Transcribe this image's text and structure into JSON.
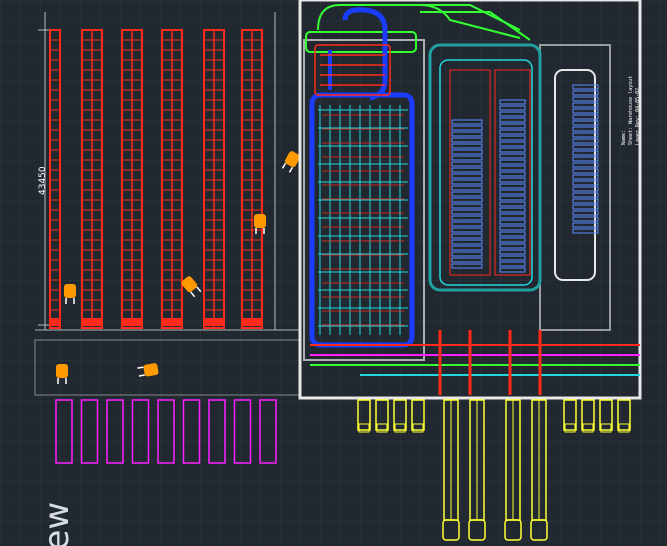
{
  "drawing": {
    "dimension_label": "43450",
    "view_label": "iew",
    "legend_lines": [
      "Name:",
      "Sheet:   Warehouse layout",
      "Layer Rev: 04-05-02"
    ],
    "colors": {
      "background": "#212830",
      "grid": "#2c353e",
      "racks": "#ff2a1a",
      "dock": "#ff20ff",
      "trucks": "#ffff33",
      "conveyor_blue": "#1a3cff",
      "conveyor_cyan": "#22d8e0",
      "green": "#33ff33",
      "outline_white": "#e8e8e8",
      "teal": "#20a0a0",
      "forklift": "#ff9900"
    }
  }
}
